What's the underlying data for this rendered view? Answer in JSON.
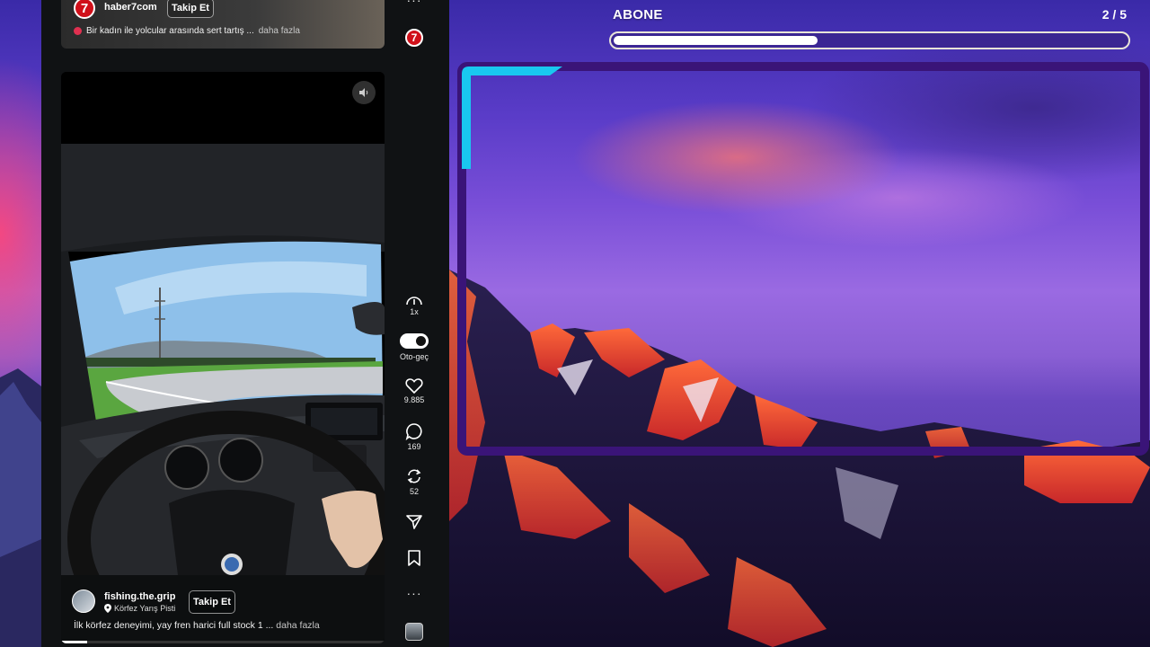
{
  "overlay": {
    "goal_label": "ABONE",
    "goal_count": "2 / 5",
    "goal_fraction": 0.4,
    "frame_accent_color": "#19c8f0",
    "frame_color": "#3a1478"
  },
  "feed": {
    "top_post": {
      "avatar_text": "7",
      "username": "haber7com",
      "follow_label": "Takip Et",
      "caption": "Bir kadın ile yolcular arasında sert tartış ...",
      "more_label": "daha fazla"
    },
    "video_post": {
      "username": "fishing.the.grip",
      "location": "Körfez Yarış Pisti",
      "follow_label": "Takip Et",
      "caption": "İlk körfez deneyimi, yay fren harici full stock 1 ...",
      "more_label": "daha fazla",
      "progress_fraction": 0.08
    }
  },
  "rail": {
    "top_more": "···",
    "logo_text": "7",
    "speed_label": "1x",
    "autoplay_label": "Oto-geç",
    "autoplay_on": true,
    "likes": "9.885",
    "comments": "169",
    "reposts": "52",
    "bottom_more": "···",
    "icons": [
      "speed-icon",
      "toggle",
      "heart-icon",
      "comment-icon",
      "repost-icon",
      "send-icon",
      "bookmark-icon",
      "more-icon"
    ]
  }
}
